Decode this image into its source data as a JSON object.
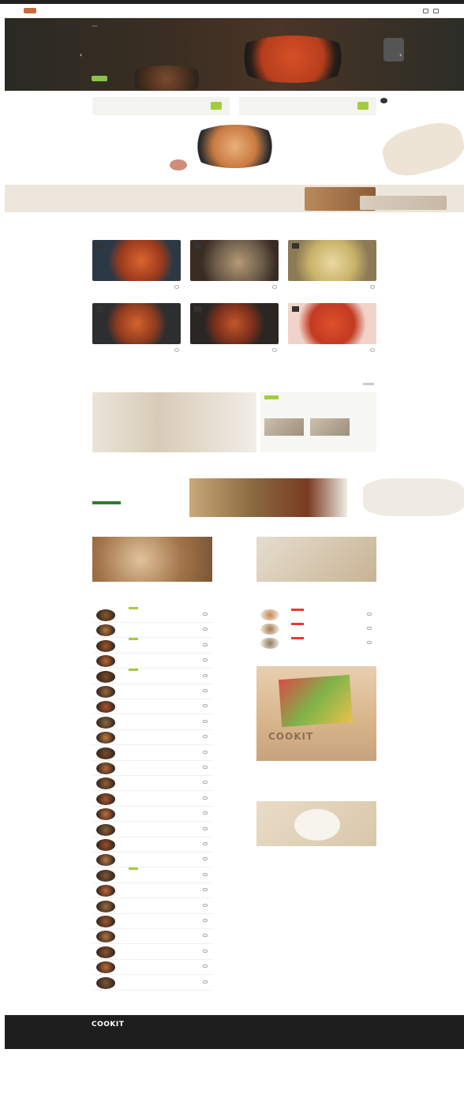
{
  "header": {
    "nav": [
      "",
      "",
      "",
      "",
      ""
    ]
  },
  "hero": {
    "title": "",
    "subtitle": "",
    "tag": ""
  },
  "promos": [
    {
      "text": ""
    },
    {
      "text": ""
    }
  ],
  "featured": {
    "title": "",
    "subtitle": "",
    "detail": ""
  },
  "band": {
    "title": "",
    "subtitle": "",
    "price": ""
  },
  "sections": {
    "recipes_title": "",
    "mag_title": "",
    "weekly_title": ""
  },
  "recipes": [
    {
      "name": "",
      "price": ""
    },
    {
      "name": "",
      "price": ""
    },
    {
      "name": "",
      "price": ""
    },
    {
      "name": "",
      "price": ""
    },
    {
      "name": "",
      "price": ""
    },
    {
      "name": "",
      "price": ""
    }
  ],
  "magazine": {
    "title": "",
    "desc": "",
    "thumbs": [
      "",
      ""
    ]
  },
  "weekly": {
    "text": ""
  },
  "left_col": {
    "title": "",
    "desc": ""
  },
  "right_col": {
    "title": "",
    "desc": ""
  },
  "poster": {
    "brand": "COOKIT",
    "title": "",
    "desc": ""
  },
  "plate": {
    "title": "",
    "desc": ""
  },
  "footer": {
    "brand": "COOKIT",
    "links": [
      "",
      "",
      "",
      ""
    ],
    "info": "",
    "cs": ""
  },
  "colors": {
    "accent": "#a4cc3a",
    "dark": "#1e1e1e",
    "red": "#e53935"
  }
}
